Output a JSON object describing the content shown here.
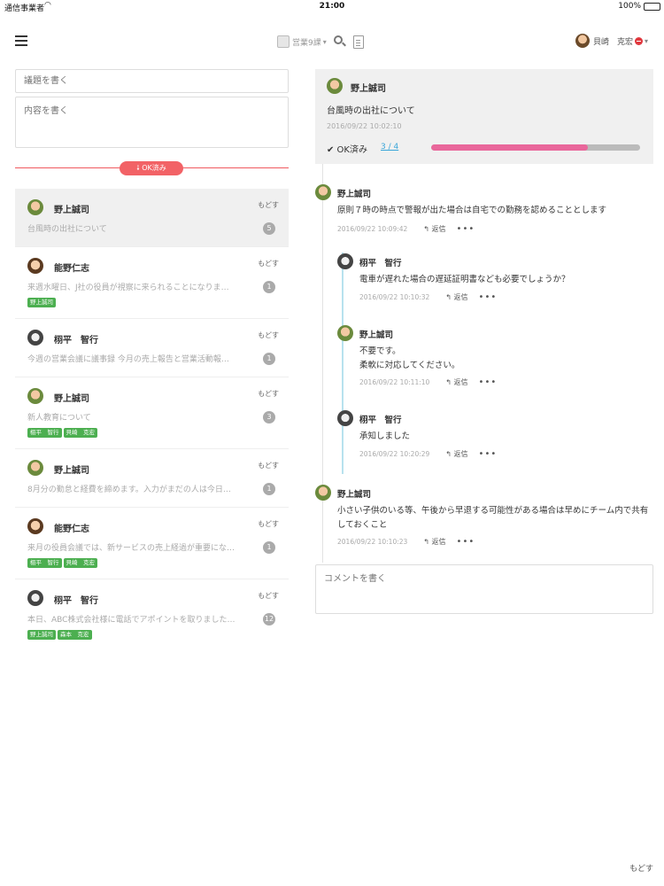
{
  "status_bar": {
    "carrier": "通信事業者",
    "time": "21:00",
    "battery": "100%"
  },
  "nav": {
    "org_name": "営業9課",
    "user_name": "貝崎　克宏"
  },
  "composer": {
    "title_placeholder": "議題を書く",
    "body_placeholder": "内容を書く",
    "ok_filter_label": "OK済み"
  },
  "threads": [
    {
      "author": "野上誠司",
      "preview": "台風時の出社について",
      "count": "5",
      "back": "もどす",
      "tags": []
    },
    {
      "author": "能野仁志",
      "preview": "来週水曜日、J社の役員が視察に来られることになりま…",
      "count": "1",
      "back": "もどす",
      "tags": [
        "野上誠司"
      ]
    },
    {
      "author": "栩平　智行",
      "preview": "今週の営業会議に議事録 今月の売上報告と営業活動報…",
      "count": "1",
      "back": "もどす",
      "tags": []
    },
    {
      "author": "野上誠司",
      "preview": "新人教育について",
      "count": "3",
      "back": "もどす",
      "tags": [
        "栩平　智行",
        "貝崎　克宏"
      ]
    },
    {
      "author": "野上誠司",
      "preview": "8月分の勤怠と経費を締めます。入力がまだの人は今日…",
      "count": "1",
      "back": "もどす",
      "tags": []
    },
    {
      "author": "能野仁志",
      "preview": "来月の役員会議では、新サービスの売上経過が重要にな…",
      "count": "1",
      "back": "もどす",
      "tags": [
        "栩平　智行",
        "貝崎　克宏"
      ]
    },
    {
      "author": "栩平　智行",
      "preview": "本日、ABC株式会社様に電話でアポイントを取りました…",
      "count": "12",
      "back": "もどす",
      "tags": [
        "野上誠司",
        "森本　克宏"
      ]
    }
  ],
  "detail": {
    "head": {
      "author": "野上誠司",
      "title": "台風時の出社について",
      "date": "2016/09/22 10:02:10",
      "ok_label": "✔ OK済み",
      "ok_count": "3 / 4",
      "ok_fraction": 0.75
    },
    "reply_label": "返信",
    "more_label": "•••",
    "replies": [
      {
        "author": "野上誠司",
        "body": "原則７時の時点で警報が出た場合は自宅での勤務を認めることとします",
        "date": "2016/09/22 10:09:42"
      },
      {
        "author": "栩平　智行",
        "body": "電車が遅れた場合の遅延証明書なども必要でしょうか？",
        "date": "2016/09/22 10:10:32"
      },
      {
        "author": "野上誠司",
        "body": "不要です。\n柔軟に対応してください。",
        "date": "2016/09/22 10:11:10"
      },
      {
        "author": "栩平　智行",
        "body": "承知しました",
        "date": "2016/09/22 10:20:29"
      },
      {
        "author": "野上誠司",
        "body": "小さい子供のいる等、午後から早退する可能性がある場合は早めにチーム内で共有\nしておくこと",
        "date": "2016/09/22 10:10:23"
      }
    ],
    "comment_placeholder": "コメントを書く"
  },
  "footer": {
    "back": "もどす"
  },
  "colors": {
    "accent_red": "#f05a5f",
    "ok_bar": "#e9679b",
    "tag_green": "#4caf50",
    "link_blue": "#3aa6d9"
  }
}
